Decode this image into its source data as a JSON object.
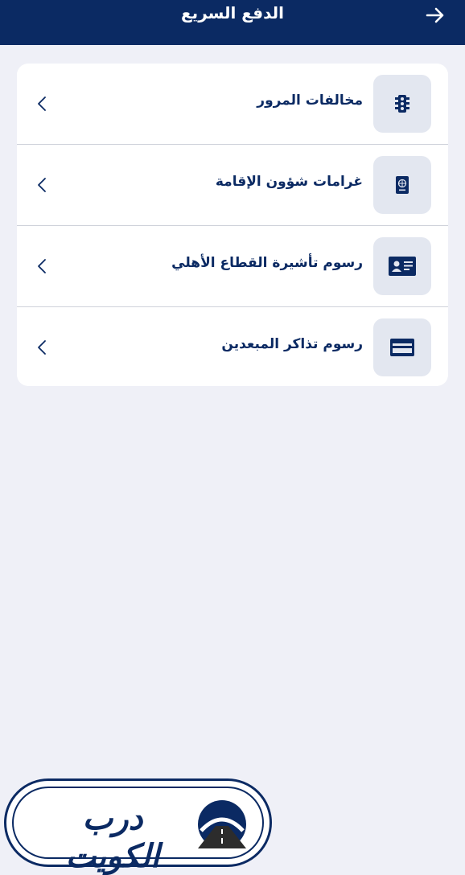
{
  "header": {
    "title": "الدفع السريع",
    "back_icon": "arrow-right-icon"
  },
  "menu": {
    "items": [
      {
        "label": "مخالفات المرور",
        "icon": "traffic-light-icon"
      },
      {
        "label": "غرامات شؤون الإقامة",
        "icon": "passport-icon"
      },
      {
        "label": "رسوم تأشيرة القطاع الأهلي",
        "icon": "id-card-icon"
      },
      {
        "label": "رسوم تذاكر المبعدين",
        "icon": "payment-card-icon"
      }
    ],
    "chevron_icon": "chevron-left-icon"
  },
  "watermark": {
    "text": "درب الكويت"
  },
  "colors": {
    "primary": "#0b2a63",
    "background": "#eff0f7",
    "icon_tile": "#e3e7f0",
    "divider": "#cfd2da"
  }
}
